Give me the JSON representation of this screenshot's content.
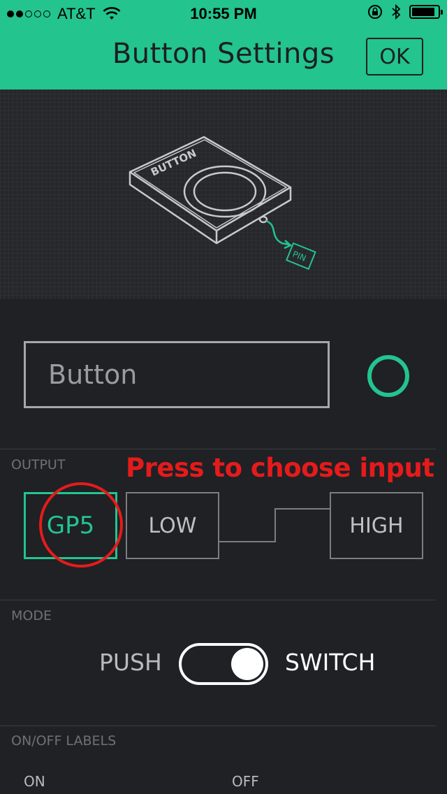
{
  "status_bar": {
    "carrier": "AT&T",
    "time": "10:55 PM",
    "signal_bars_filled": 2,
    "signal_bars_total": 5,
    "battery_level": 0.9
  },
  "nav": {
    "title": "Button Settings",
    "ok_label": "OK"
  },
  "preview": {
    "widget_label": "BUTTON",
    "pin_label": "PIN"
  },
  "widget_name": {
    "value": "Button"
  },
  "colors": {
    "accent": "#23c48e",
    "background": "#1f2125",
    "annotation": "#e51b1b"
  },
  "output": {
    "section_label": "OUTPUT",
    "pin": "GP5",
    "low_label": "LOW",
    "high_label": "HIGH"
  },
  "annotation": {
    "text": "Press to choose input"
  },
  "mode": {
    "section_label": "MODE",
    "push_label": "PUSH",
    "switch_label": "SWITCH",
    "selected": "SWITCH"
  },
  "onoff_labels": {
    "section_label": "ON/OFF LABELS",
    "on_label": "ON",
    "off_label": "OFF"
  }
}
